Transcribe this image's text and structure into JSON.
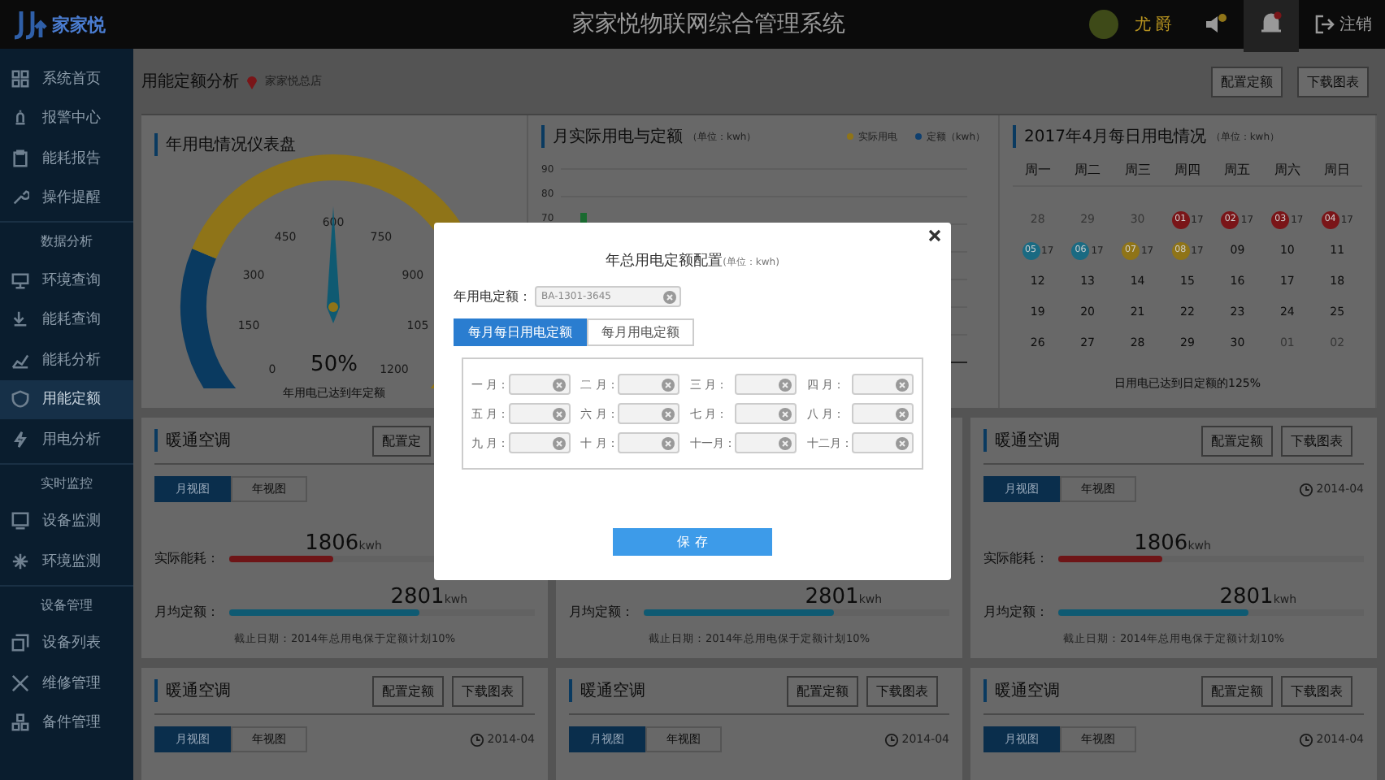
{
  "top_bar": {
    "logo_text": "家家悦",
    "title": "家家悦物联网综合管理系统",
    "user_name": "尤 爵",
    "logout": "注销"
  },
  "sidebar": [
    {
      "kind": "item",
      "label": "系统首页",
      "selected": false
    },
    {
      "kind": "item",
      "label": "报警中心",
      "selected": false
    },
    {
      "kind": "item",
      "label": "能耗报告",
      "selected": false
    },
    {
      "kind": "item",
      "label": "操作提醒",
      "selected": false
    },
    {
      "kind": "section",
      "label": "数据分析"
    },
    {
      "kind": "item",
      "label": "环境查询",
      "selected": false
    },
    {
      "kind": "item",
      "label": "能耗查询",
      "selected": false
    },
    {
      "kind": "item",
      "label": "能耗分析",
      "selected": false
    },
    {
      "kind": "item",
      "label": "用能定额",
      "selected": true
    },
    {
      "kind": "item",
      "label": "用电分析",
      "selected": false
    },
    {
      "kind": "section",
      "label": "实时监控"
    },
    {
      "kind": "item",
      "label": "设备监测",
      "selected": false
    },
    {
      "kind": "item",
      "label": "环境监测",
      "selected": false
    },
    {
      "kind": "section",
      "label": "设备管理"
    },
    {
      "kind": "item",
      "label": "设备列表",
      "selected": false
    },
    {
      "kind": "item",
      "label": "维修管理",
      "selected": false
    },
    {
      "kind": "item",
      "label": "备件管理",
      "selected": false
    }
  ],
  "page_header": {
    "title": "用能定额分析",
    "location": "家家悦总店",
    "buttons": [
      "配置定额",
      "下载图表"
    ]
  },
  "gauge_panel": {
    "title": "年用电情况仪表盘",
    "ticks": [
      "0",
      "150",
      "300",
      "450",
      "600",
      "750",
      "900",
      "105",
      "1200"
    ],
    "level": 0.5,
    "percent": "50%",
    "caption": "年用电已达到年定额"
  },
  "bar_panel": {
    "title": "月实际用电与定额",
    "unit": "（单位：kwh）",
    "legend": [
      {
        "label": "实际用电",
        "color": "#8f7418"
      },
      {
        "label": "定额（kwh）",
        "color": "#0f3f6e"
      }
    ],
    "y_labels": [
      "90",
      "80",
      "70"
    ]
  },
  "calendar_panel": {
    "title": "2017年4月每日用电情况",
    "unit": "（单位：kwh）",
    "weekdays": [
      "周一",
      "周二",
      "周三",
      "周四",
      "周五",
      "周六",
      "周日"
    ],
    "weeks": [
      [
        {
          "kind": "muted",
          "day": "28"
        },
        {
          "kind": "muted",
          "day": "29"
        },
        {
          "kind": "muted",
          "day": "30"
        },
        {
          "kind": "badge",
          "day": "01",
          "value": "17",
          "color": "#7a1518"
        },
        {
          "kind": "badge",
          "day": "02",
          "value": "17",
          "color": "#7a1518"
        },
        {
          "kind": "badge",
          "day": "03",
          "value": "17",
          "color": "#7a1518"
        },
        {
          "kind": "badge",
          "day": "04",
          "value": "17",
          "color": "#7a1518"
        }
      ],
      [
        {
          "kind": "badge",
          "day": "05",
          "value": "17",
          "color": "#1a6a82"
        },
        {
          "kind": "badge",
          "day": "06",
          "value": "17",
          "color": "#1a6a82"
        },
        {
          "kind": "badge",
          "day": "07",
          "value": "17",
          "color": "#8f7418"
        },
        {
          "kind": "badge",
          "day": "08",
          "value": "17",
          "color": "#8f7418"
        },
        {
          "kind": "day",
          "day": "09"
        },
        {
          "kind": "day",
          "day": "10"
        },
        {
          "kind": "day",
          "day": "11"
        }
      ],
      [
        {
          "kind": "day",
          "day": "12"
        },
        {
          "kind": "day",
          "day": "13"
        },
        {
          "kind": "day",
          "day": "14"
        },
        {
          "kind": "day",
          "day": "15"
        },
        {
          "kind": "day",
          "day": "16"
        },
        {
          "kind": "day",
          "day": "17"
        },
        {
          "kind": "day",
          "day": "18"
        }
      ],
      [
        {
          "kind": "day",
          "day": "19"
        },
        {
          "kind": "day",
          "day": "20"
        },
        {
          "kind": "day",
          "day": "21"
        },
        {
          "kind": "day",
          "day": "22"
        },
        {
          "kind": "day",
          "day": "23"
        },
        {
          "kind": "day",
          "day": "24"
        },
        {
          "kind": "day",
          "day": "25"
        }
      ],
      [
        {
          "kind": "day",
          "day": "26"
        },
        {
          "kind": "day",
          "day": "27"
        },
        {
          "kind": "day",
          "day": "28"
        },
        {
          "kind": "day",
          "day": "29"
        },
        {
          "kind": "day",
          "day": "30"
        },
        {
          "kind": "muted",
          "day": "01"
        },
        {
          "kind": "muted",
          "day": "02"
        }
      ]
    ],
    "footer": "日用电已达到日定额的125%"
  },
  "cards": [
    {
      "title": "暖通空调",
      "buttons": [
        "配置定"
      ],
      "tabs": [
        {
          "label": "月视图",
          "selected": true
        },
        {
          "label": "年视图",
          "selected": false
        }
      ],
      "actual": {
        "label": "实际能耗：",
        "value": "1806",
        "unit": "kwh",
        "level": 0.34
      },
      "quota": {
        "label": "月均定额：",
        "value": "2801",
        "unit": "kwh",
        "level": 0.62
      },
      "footer": "截止日期：2014年总用电保于定额计划10%"
    },
    {
      "quota": {
        "label": "月均定额：",
        "value": "2801",
        "unit": "kwh",
        "level": 0.62
      },
      "footer": "截止日期：2014年总用电保于定额计划10%"
    },
    {
      "title": "暖通空调",
      "buttons": [
        "配置定额",
        "下载图表"
      ],
      "tabs": [
        {
          "label": "月视图",
          "selected": true
        },
        {
          "label": "年视图",
          "selected": false
        }
      ],
      "date": "2014-04",
      "actual": {
        "label": "实际能耗：",
        "value": "1806",
        "unit": "kwh",
        "level": 0.34
      },
      "quota": {
        "label": "月均定额：",
        "value": "2801",
        "unit": "kwh",
        "level": 0.62
      },
      "footer": "截止日期：2014年总用电保于定额计划10%"
    },
    {
      "title": "暖通空调",
      "buttons": [
        "配置定额",
        "下载图表"
      ],
      "tabs": [
        {
          "label": "月视图",
          "selected": true
        },
        {
          "label": "年视图",
          "selected": false
        }
      ],
      "date": "2014-04"
    },
    {
      "title": "暖通空调",
      "buttons": [
        "配置定额",
        "下载图表"
      ],
      "tabs": [
        {
          "label": "月视图",
          "selected": true
        },
        {
          "label": "年视图",
          "selected": false
        }
      ],
      "date": "2014-04"
    },
    {
      "title": "暖通空调",
      "buttons": [
        "配置定额",
        "下载图表"
      ],
      "tabs": [
        {
          "label": "月视图",
          "selected": true
        },
        {
          "label": "年视图",
          "selected": false
        }
      ],
      "date": "2014-04"
    }
  ],
  "dialog": {
    "title": "年总用电定额配置",
    "unit": "(单位：kwh)",
    "annual_label": "年用电定额：",
    "annual_placeholder": "BA-1301-3645",
    "tabs": [
      {
        "label": "每月每日用电定额",
        "selected": true
      },
      {
        "label": "每月用电定额",
        "selected": false
      }
    ],
    "months": [
      "一 月：",
      "二 月：",
      "三 月：",
      "四 月：",
      "五 月：",
      "六 月：",
      "七 月：",
      "八 月：",
      "九 月：",
      "十 月：",
      "十一月：",
      "十二月："
    ],
    "save": "保 存"
  }
}
